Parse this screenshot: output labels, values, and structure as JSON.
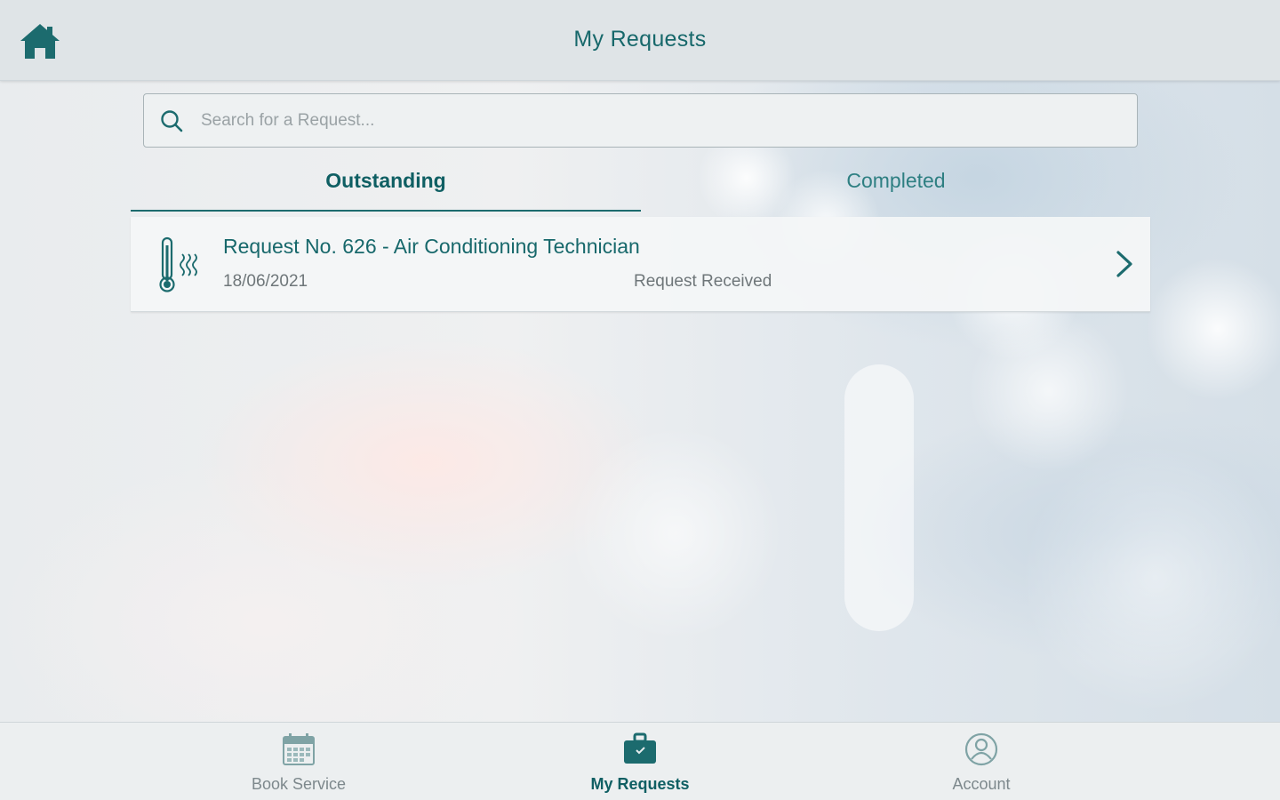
{
  "header": {
    "title": "My Requests",
    "home_icon": "home-icon"
  },
  "search": {
    "placeholder": "Search for a Request...",
    "value": "",
    "icon": "search-icon"
  },
  "tabs": [
    {
      "label": "Outstanding",
      "active": true
    },
    {
      "label": "Completed",
      "active": false
    }
  ],
  "requests": [
    {
      "title": "Request No. 626 - Air Conditioning Technician",
      "date": "18/06/2021",
      "status": "Request Received",
      "icon": "thermometer-icon"
    }
  ],
  "bottom_nav": {
    "items": [
      {
        "label": "Book Service",
        "icon": "calendar-icon",
        "active": false
      },
      {
        "label": "My Requests",
        "icon": "briefcase-icon",
        "active": true
      },
      {
        "label": "Account",
        "icon": "user-icon",
        "active": false
      }
    ]
  },
  "colors": {
    "primary": "#17686b",
    "active_tab": "#0f5f63",
    "muted_text": "#6e7679",
    "bar_bg": "#dfe4e7"
  }
}
